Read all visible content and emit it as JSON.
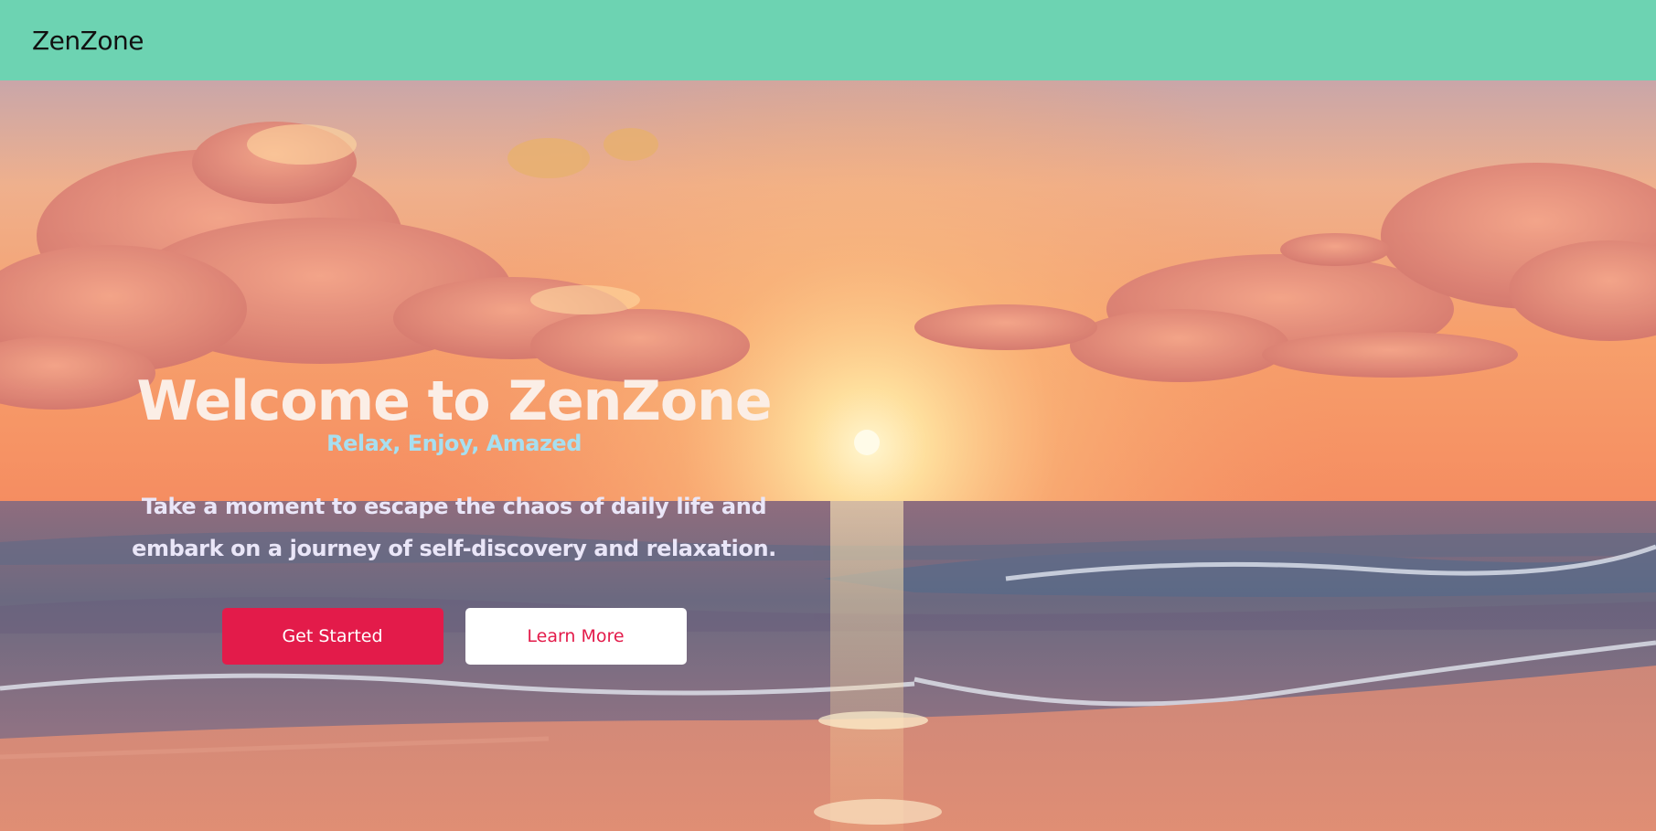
{
  "nav": {
    "brand": "ZenZone"
  },
  "hero": {
    "title": "Welcome to ZenZone",
    "tagline": "Relax, Enjoy, Amazed",
    "description": "Take a moment to escape the chaos of daily life and embark on a journey of self-discovery and relaxation.",
    "primary_button": "Get Started",
    "secondary_button": "Learn More"
  },
  "colors": {
    "navbar": "#6dd3b2",
    "accent": "#e31b4a"
  }
}
